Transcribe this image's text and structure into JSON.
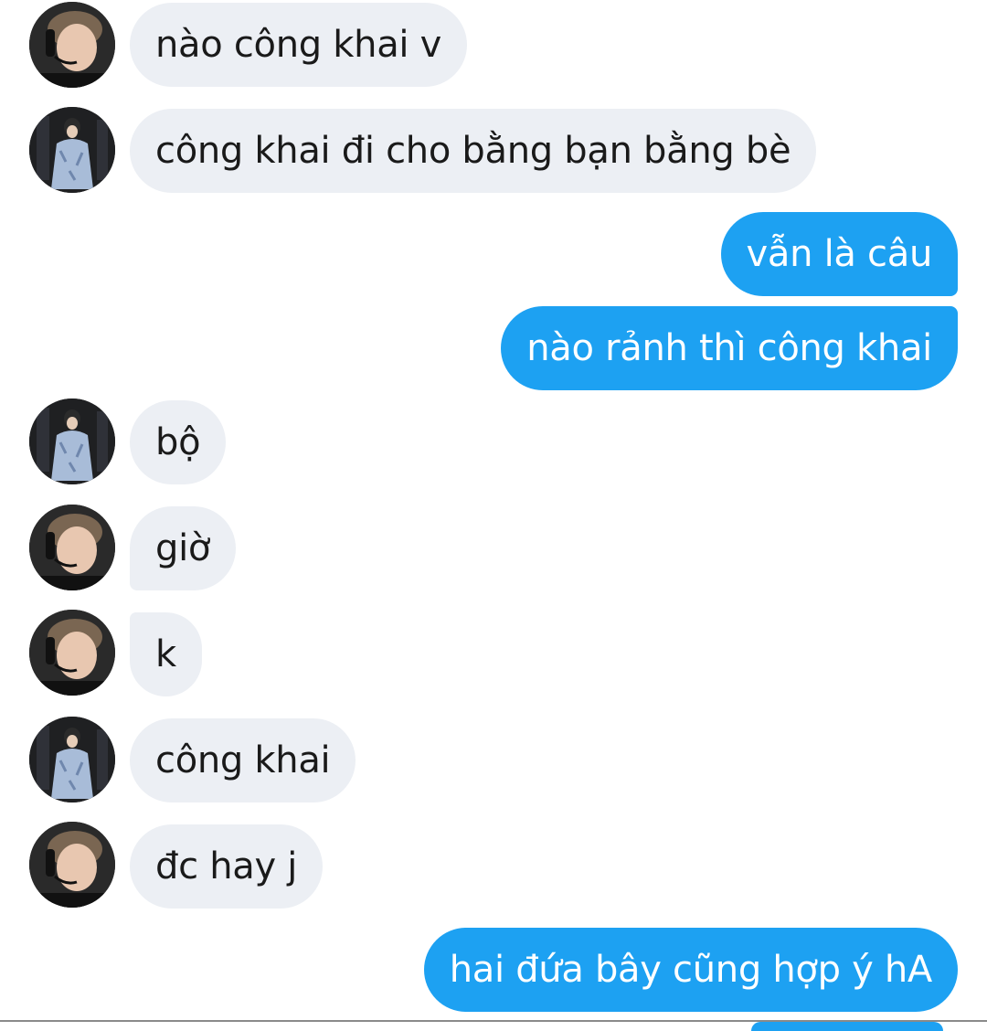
{
  "conversation": {
    "messages": [
      {
        "side": "in",
        "avatar": "headset-boy",
        "text": "nào công khai v",
        "shape": "single"
      },
      {
        "side": "in",
        "avatar": "denim-jacket-boy",
        "text": "công khai đi cho bằng bạn bằng bè",
        "shape": "single"
      },
      {
        "side": "out",
        "text": "vẫn là câu",
        "shape": "top"
      },
      {
        "side": "out",
        "text": "nào rảnh thì công khai",
        "shape": "bot"
      },
      {
        "side": "in",
        "avatar": "denim-jacket-boy",
        "text": "bộ",
        "shape": "single"
      },
      {
        "side": "in",
        "avatar": "headset-boy",
        "text": "giờ",
        "shape": "top"
      },
      {
        "side": "in",
        "avatar": "headset-boy",
        "text": "k",
        "shape": "bot"
      },
      {
        "side": "in",
        "avatar": "denim-jacket-boy",
        "text": "công khai",
        "shape": "single"
      },
      {
        "side": "in",
        "avatar": "headset-boy",
        "text": "đc hay j",
        "shape": "single"
      },
      {
        "side": "out",
        "text": "hai đứa bây cũng hợp ý hA",
        "shape": "single"
      }
    ]
  },
  "colors": {
    "incoming_bubble": "#eceff4",
    "outgoing_bubble": "#1da1f2",
    "incoming_text": "#1a1a1a",
    "outgoing_text": "#ffffff"
  }
}
